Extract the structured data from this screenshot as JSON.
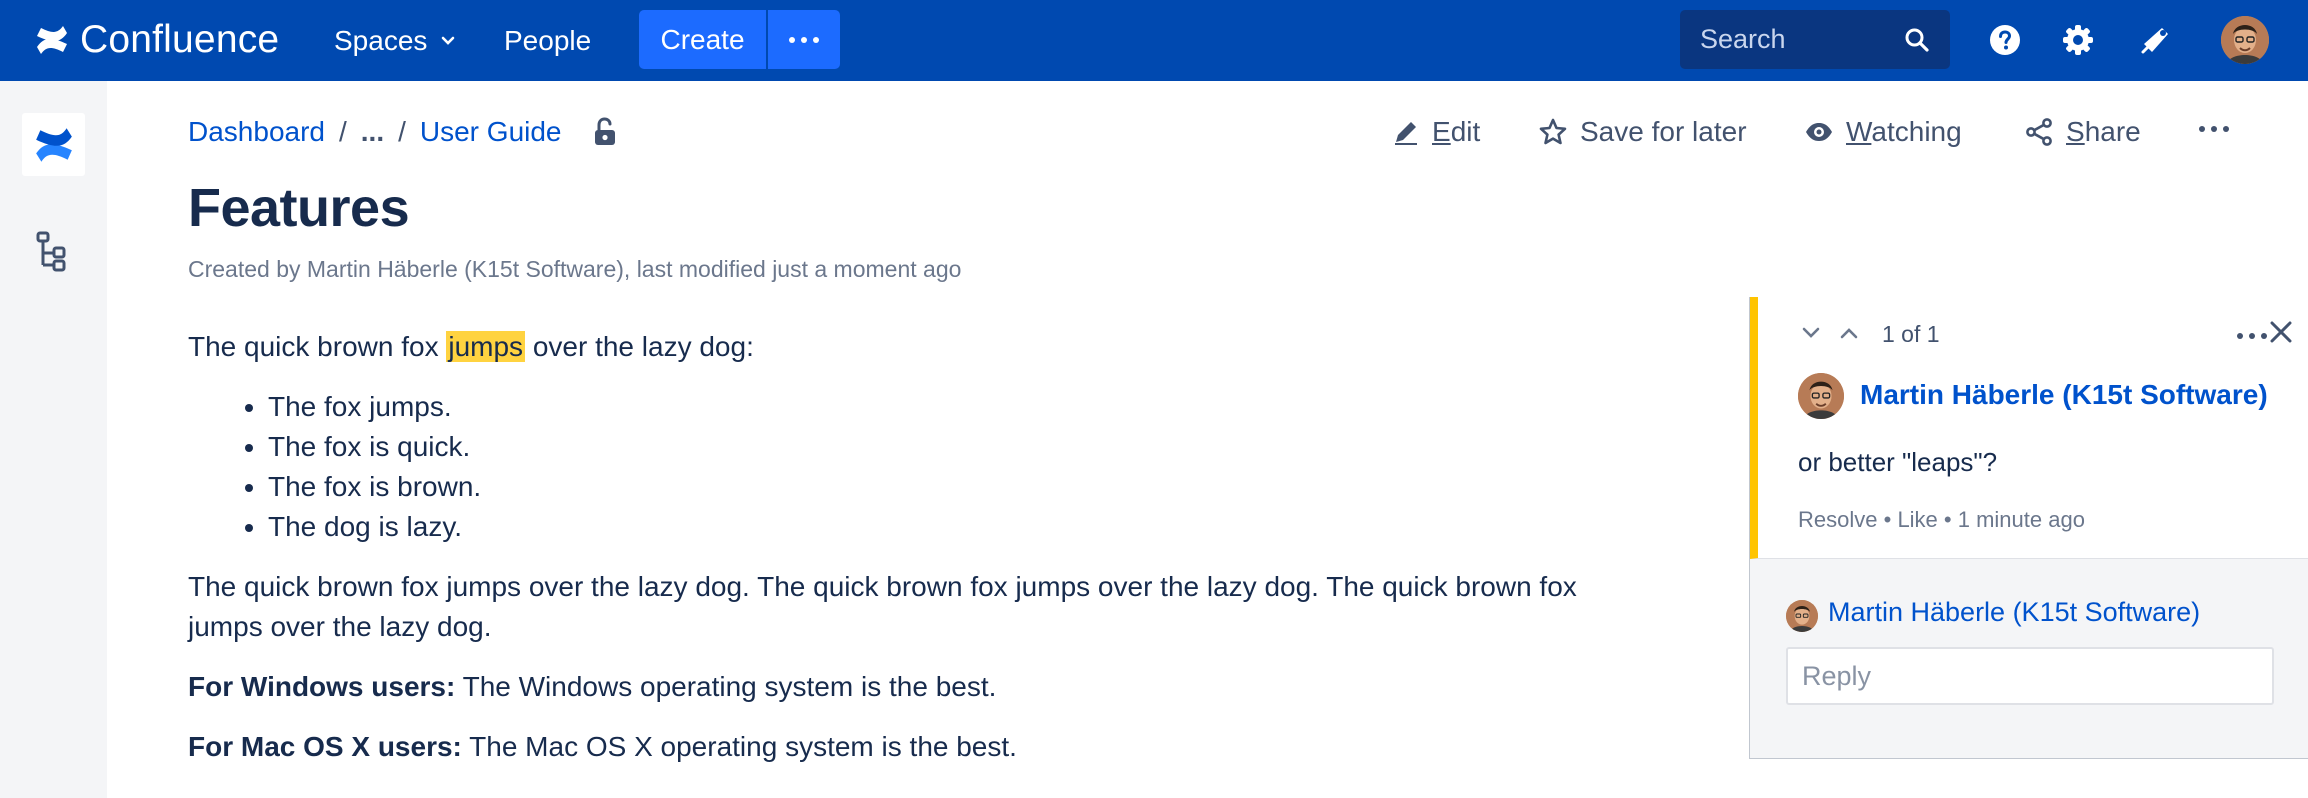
{
  "app": {
    "name": "Confluence"
  },
  "topnav": {
    "spaces_label": "Spaces",
    "people_label": "People",
    "create_label": "Create",
    "search_placeholder": "Search",
    "icons": [
      "help-icon",
      "settings-icon",
      "notifications-icon",
      "user-avatar"
    ],
    "bg_color": "#0049b0",
    "create_color": "#1c6bff"
  },
  "breadcrumbs": {
    "items": [
      "Dashboard",
      "...",
      "User Guide"
    ]
  },
  "page_actions": {
    "edit_label": "Edit",
    "save_label": "Save for later",
    "watch_label": "Watching",
    "share_label": "Share"
  },
  "page": {
    "title": "Features",
    "meta": "Created by Martin Häberle (K15t Software), last modified just a moment ago",
    "intro_before": "The quick brown fox ",
    "intro_highlight": "jumps",
    "intro_after": " over the lazy dog:",
    "bullets": [
      "The fox jumps.",
      "The fox is quick.",
      "The fox is brown.",
      "The dog is lazy."
    ],
    "paragraph": "The quick brown fox jumps over the lazy dog. The quick brown fox jumps over the lazy dog. The quick brown fox jumps over the lazy dog.",
    "windows_label": "For Windows users:",
    "windows_text": " The Windows operating system is the best.",
    "mac_label": "For Mac OS X users:",
    "mac_text": " The Mac OS X operating system is the best."
  },
  "comment": {
    "counter": "1 of 1",
    "author": "Martin Häberle (K15t Software)",
    "body": "or better \"leaps\"?",
    "resolve_label": "Resolve",
    "like_label": "Like",
    "time": "1 minute ago",
    "reply_author": "Martin Häberle (K15t Software)",
    "reply_placeholder": "Reply",
    "accent_color": "#ffc400"
  }
}
